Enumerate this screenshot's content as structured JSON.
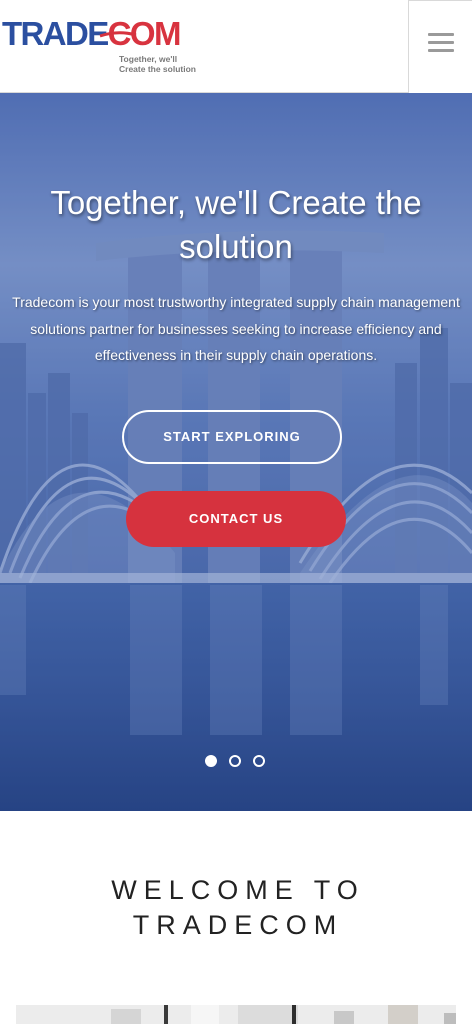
{
  "header": {
    "logo_part1": "TRADE",
    "logo_part2": "COM",
    "logo_tagline_line1": "Together, we'll",
    "logo_tagline_line2": "Create the solution",
    "menu_icon": "hamburger-menu-icon"
  },
  "hero": {
    "title": "Together, we'll Create the solution",
    "description": "Tradecom is your most trustworthy integrated supply chain management solutions partner for businesses seeking to increase efficiency and effectiveness in their supply chain operations.",
    "explore_label": "START EXPLORING",
    "contact_label": "CONTACT US",
    "slides_total": 3,
    "active_slide": 1
  },
  "welcome": {
    "title": "WELCOME TO TRADECOM"
  },
  "colors": {
    "brand_blue": "#2b4fa0",
    "brand_red": "#d6323e",
    "text_dark": "#222222"
  }
}
